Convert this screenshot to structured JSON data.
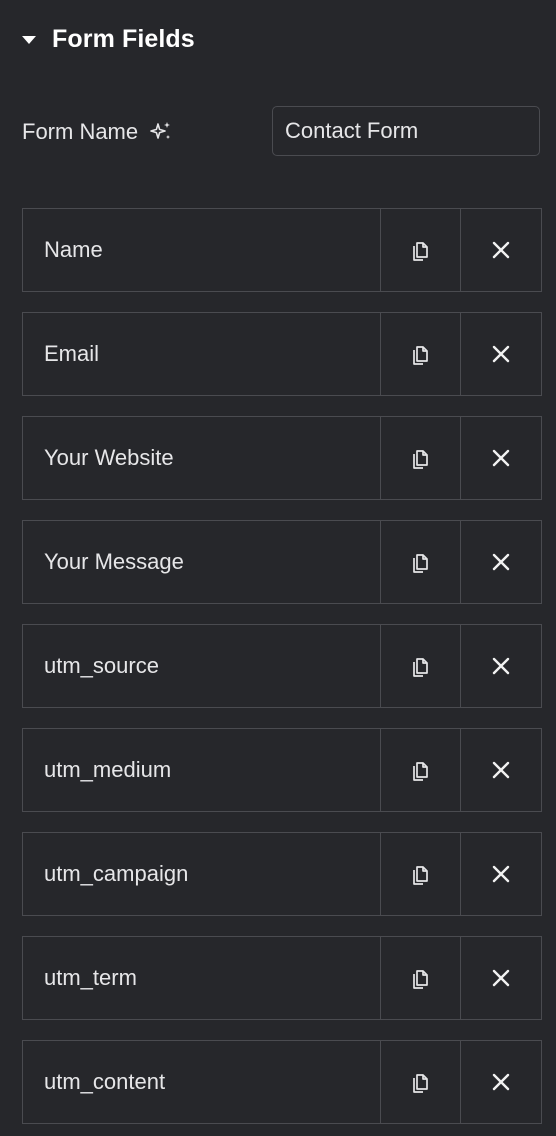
{
  "section": {
    "title": "Form Fields",
    "caret_icon": "caret-down-icon"
  },
  "form_name": {
    "label": "Form Name",
    "ai_icon": "sparkle-icon",
    "value": "Contact Form"
  },
  "fields": [
    {
      "label": "Name"
    },
    {
      "label": "Email"
    },
    {
      "label": "Your Website"
    },
    {
      "label": "Your Message"
    },
    {
      "label": "utm_source"
    },
    {
      "label": "utm_medium"
    },
    {
      "label": "utm_campaign"
    },
    {
      "label": "utm_term"
    },
    {
      "label": "utm_content"
    }
  ],
  "row_actions": {
    "duplicate_icon": "duplicate-icon",
    "remove_icon": "close-icon"
  },
  "colors": {
    "background": "#26272b",
    "border": "#4a4b50",
    "text": "#e6e6e8"
  }
}
